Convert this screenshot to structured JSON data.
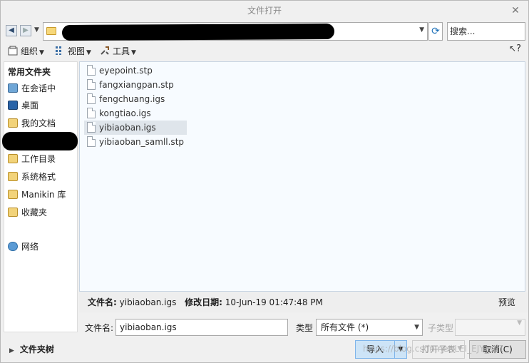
{
  "window": {
    "title": "文件打开",
    "close": "✕"
  },
  "address": {
    "prefix": "<",
    "search_placeholder": "搜索..."
  },
  "toolbar": {
    "organize": "组织",
    "view": "视图",
    "tools": "工具",
    "help": "?"
  },
  "sidebar": {
    "heading": "常用文件夹",
    "items": [
      {
        "label": "在会话中",
        "icon": "monitor-icon"
      },
      {
        "label": "桌面",
        "icon": "desktop-icon"
      },
      {
        "label": "我的文档",
        "icon": "documents-icon"
      },
      {
        "label": "工作目录",
        "icon": "workdir-icon"
      },
      {
        "label": "系统格式",
        "icon": "sysformat-icon"
      },
      {
        "label": "Manikin 库",
        "icon": "manikin-icon"
      },
      {
        "label": "收藏夹",
        "icon": "favorites-icon"
      },
      {
        "label": "网络",
        "icon": "network-icon"
      }
    ]
  },
  "files": [
    {
      "name": "eyepoint.stp",
      "selected": false
    },
    {
      "name": "fangxiangpan.stp",
      "selected": false
    },
    {
      "name": "fengchuang.igs",
      "selected": false
    },
    {
      "name": "kongtiao.igs",
      "selected": false
    },
    {
      "name": "yibiaoban.igs",
      "selected": true
    },
    {
      "name": "yibiaoban_samll.stp",
      "selected": false
    }
  ],
  "info": {
    "name_label": "文件名:",
    "name_value": "yibiaoban.igs",
    "date_label": "修改日期:",
    "date_value": "10-Jun-19 01:47:48 PM",
    "preview": "预览"
  },
  "filename": {
    "label": "文件名:",
    "value": "yibiaoban.igs"
  },
  "filetype": {
    "label": "类型",
    "value": "所有文件 (*)",
    "subtype_label": "子类型"
  },
  "footer": {
    "folder_toggle": "文件夹树",
    "import": "导入",
    "open_table": "打开子表",
    "cancel": "取消(C)"
  },
  "watermark": "https://blog.csdn.net/LEI_EJY_sd1"
}
